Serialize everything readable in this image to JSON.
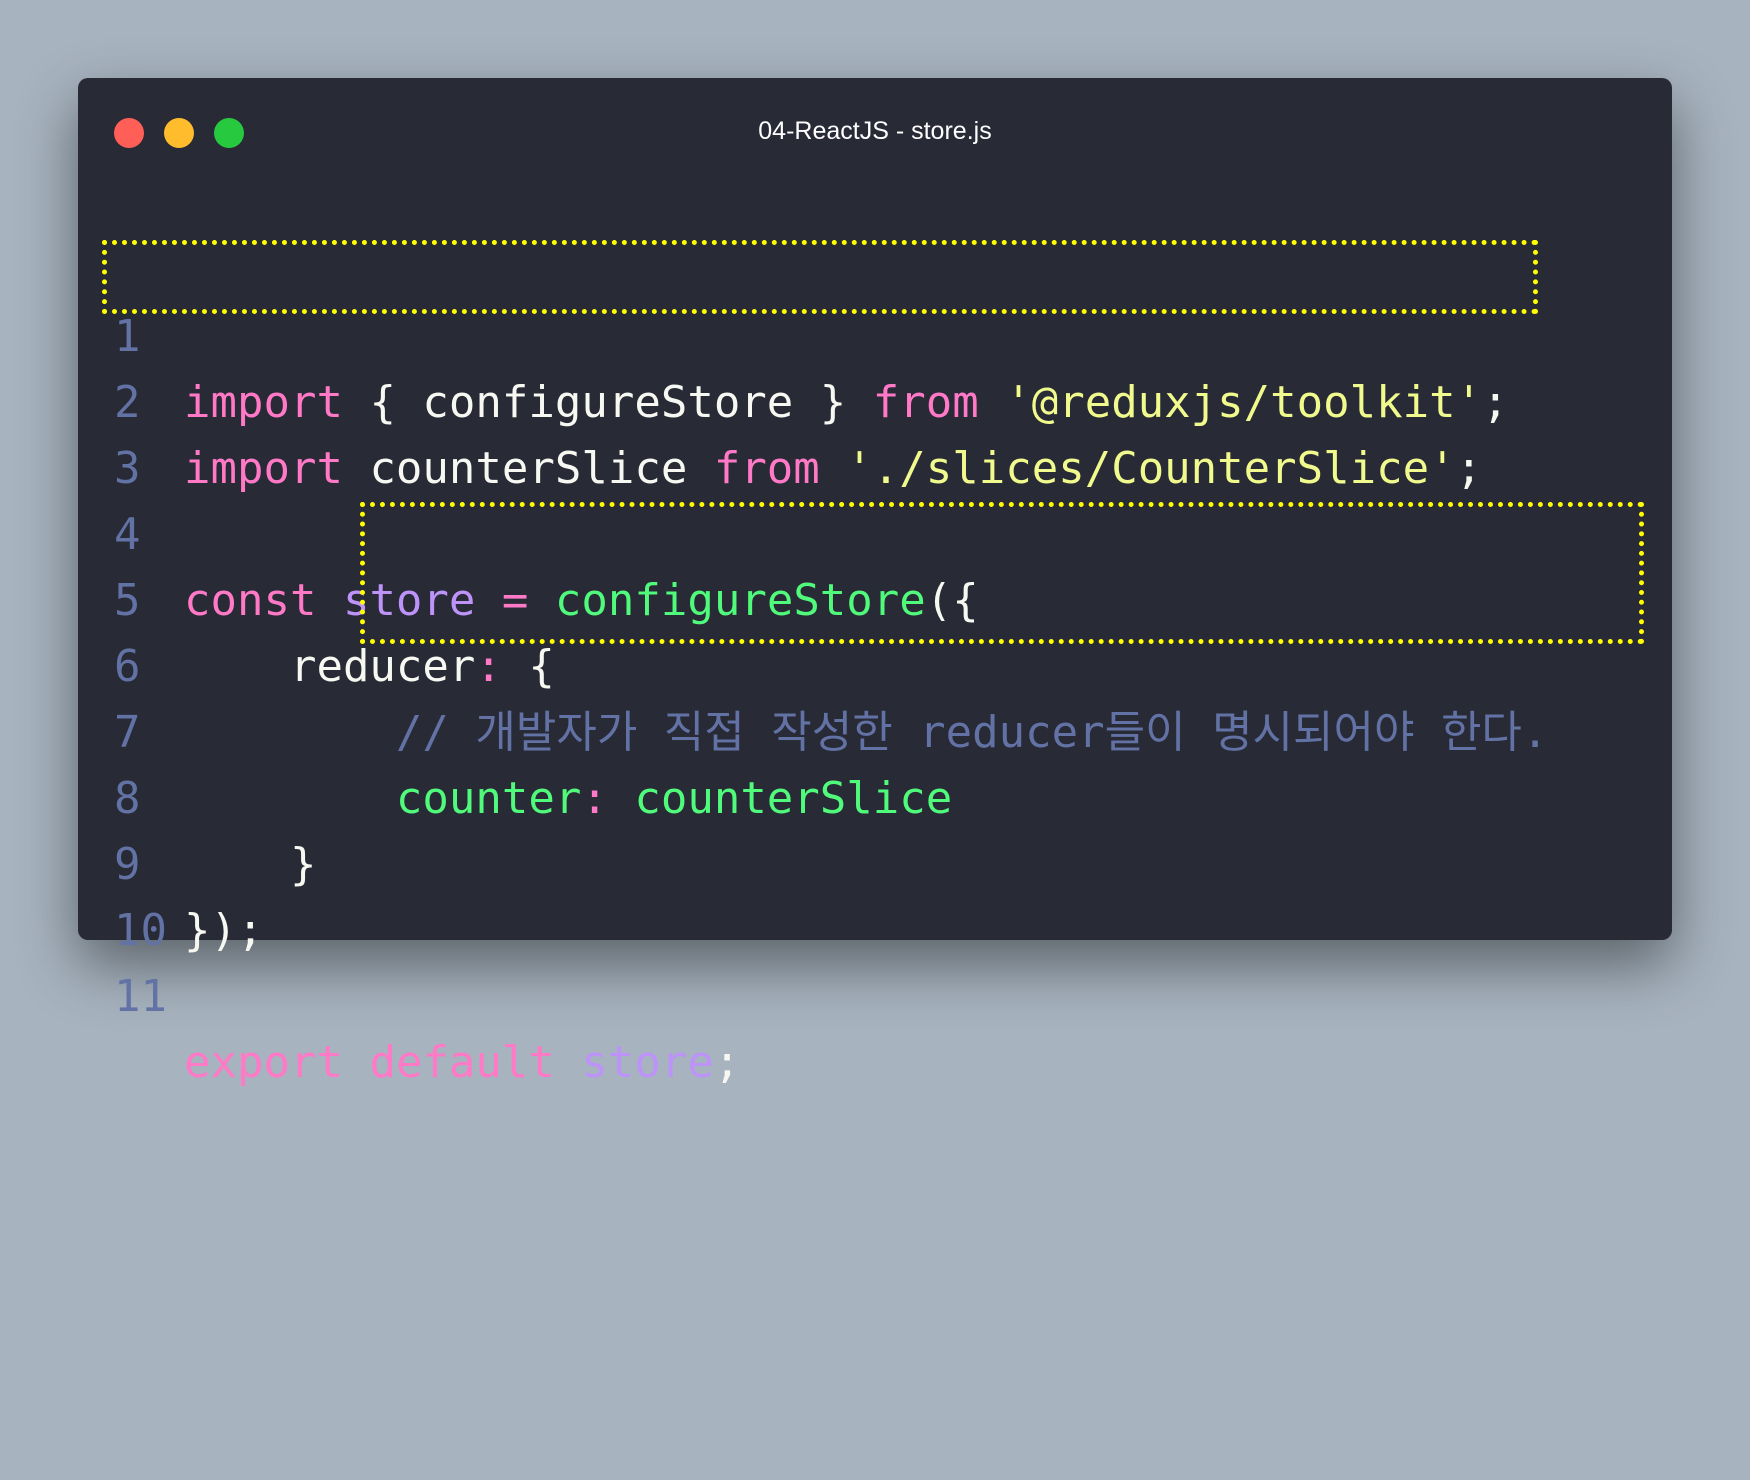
{
  "window": {
    "title": "04-ReactJS - store.js"
  },
  "colors": {
    "keyword": "#ff79c6",
    "plain": "#f8f8f2",
    "function": "#50fa7b",
    "string": "#f1fa8c",
    "variable": "#bd93f9",
    "comment": "#6272a4",
    "highlight": "#ffff00"
  },
  "lines": [
    {
      "n": "1",
      "parts": [
        "import",
        " { configureStore } ",
        "from",
        " ",
        "'@reduxjs/toolkit'",
        ";"
      ]
    },
    {
      "n": "2",
      "parts": [
        "import",
        " counterSlice ",
        "from",
        " ",
        "'./slices/CounterSlice'",
        ";"
      ]
    },
    {
      "n": "3",
      "parts": []
    },
    {
      "n": "4",
      "parts": [
        "const",
        " ",
        "store",
        " ",
        "=",
        " ",
        "configureStore",
        "({"
      ]
    },
    {
      "n": "5",
      "parts": [
        "    reducer",
        ":",
        " {"
      ]
    },
    {
      "n": "6",
      "parts": [
        "        ",
        "// 개발자가 직접 작성한 reducer들이 명시되어야 한다."
      ]
    },
    {
      "n": "7",
      "parts": [
        "        ",
        "counter",
        ":",
        " ",
        "counterSlice"
      ]
    },
    {
      "n": "8",
      "parts": [
        "    }"
      ]
    },
    {
      "n": "9",
      "parts": [
        "});"
      ]
    },
    {
      "n": "10",
      "parts": []
    },
    {
      "n": "11",
      "parts": [
        "export",
        " ",
        "default",
        " ",
        "store",
        ";"
      ]
    }
  ]
}
